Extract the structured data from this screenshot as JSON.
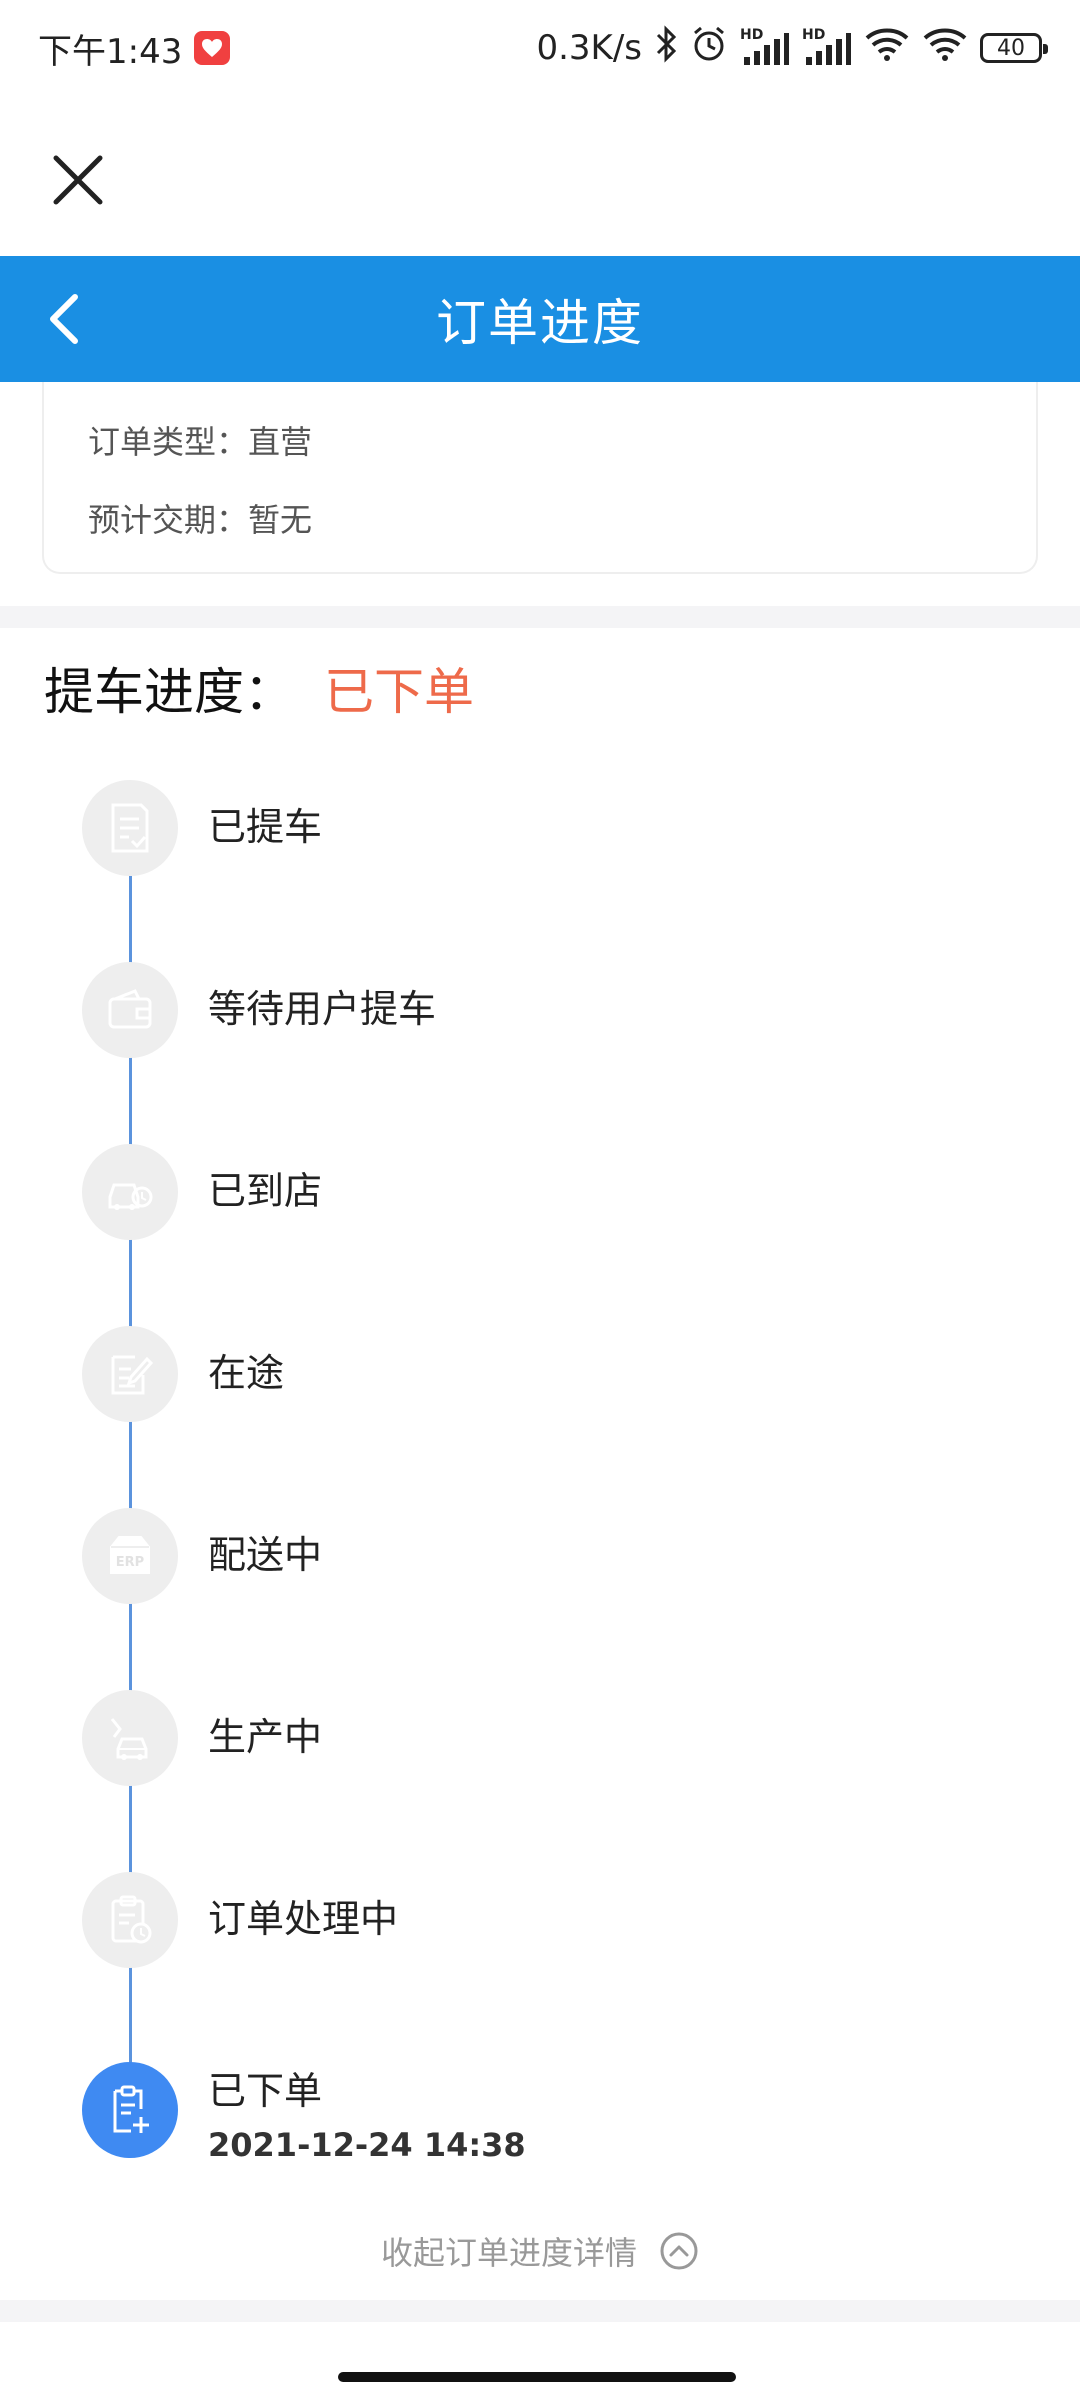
{
  "status_bar": {
    "time": "下午1:43",
    "net_speed": "0.3K/s",
    "battery": "40",
    "hd1": "HD",
    "hd2": "HD"
  },
  "header": {
    "title": "订单进度"
  },
  "info": {
    "order_type": "订单类型：直营",
    "delivery_date": "预计交期：暂无"
  },
  "progress": {
    "label": "提车进度：",
    "status": "已下单",
    "status_color": "#ee6a4a",
    "steps": [
      {
        "label": "已提车",
        "icon": "document-check-icon"
      },
      {
        "label": "等待用户提车",
        "icon": "wallet-icon"
      },
      {
        "label": "已到店",
        "icon": "car-store-icon"
      },
      {
        "label": "在途",
        "icon": "document-edit-icon"
      },
      {
        "label": "配送中",
        "icon": "erp-box-icon"
      },
      {
        "label": "生产中",
        "icon": "robot-arm-car-icon"
      },
      {
        "label": "订单处理中",
        "icon": "clipboard-clock-icon"
      },
      {
        "label": "已下单",
        "icon": "clipboard-plus-icon",
        "time": "2021-12-24 14:38",
        "active": true
      }
    ]
  },
  "collapse_label": "收起订单进度详情",
  "colors": {
    "header_blue": "#1a8fe3",
    "active_blue": "#3f8af2",
    "line_blue": "#5b93dd"
  }
}
